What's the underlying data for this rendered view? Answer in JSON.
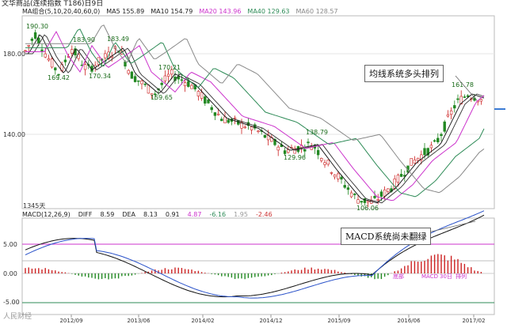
{
  "header": {
    "title": "文华商品(连续指数 T186)日9日"
  },
  "ma_legend": [
    {
      "label": "MA组合(5,10,20,40,60,0)",
      "color": "#333333"
    },
    {
      "label": "MA5 155.89",
      "color": "#111111"
    },
    {
      "label": "MA10 154.79",
      "color": "#111111"
    },
    {
      "label": "MA20 143.96",
      "color": "#cc33cc"
    },
    {
      "label": "MA40 129.63",
      "color": "#2e8b57"
    },
    {
      "label": "MA60 128.57",
      "color": "#888888"
    }
  ],
  "price_axis": {
    "labels": [
      "180.00",
      "140.00"
    ]
  },
  "price_marks": [
    "190.30",
    "169.42",
    "183.90",
    "170.34",
    "183.49",
    "159.65",
    "170.21",
    "138.79",
    "129.96",
    "106.06",
    "161.78"
  ],
  "days_label": "1345天",
  "annotations": {
    "ma_note": "均线系统多头排列",
    "macd_note": "MACD系统尚未翻绿"
  },
  "macd_legend": [
    {
      "label": "MACD(12,26,9)",
      "color": "#111111"
    },
    {
      "label": "DIFF",
      "color": "#111111"
    },
    {
      "label": "8.59",
      "color": "#111111"
    },
    {
      "label": "DEA",
      "color": "#111111"
    },
    {
      "label": "8.13",
      "color": "#111111"
    },
    {
      "label": "0.91",
      "color": "#111111"
    },
    {
      "label": "4.87",
      "color": "#cc33cc"
    },
    {
      "label": "-6.16",
      "color": "#2e8b57"
    },
    {
      "label": "1.95",
      "color": "#999999"
    },
    {
      "label": "-2.46",
      "color": "#cc3333"
    }
  ],
  "macd_axis": {
    "labels": [
      "5.00",
      "0.00",
      "-5.00"
    ]
  },
  "macd_marks": [
    "底部",
    "MACD",
    "30日",
    "排列"
  ],
  "dates": [
    "2012/09",
    "2013/06",
    "2014/02",
    "2014/12",
    "2015/09",
    "2016/06",
    "2017/02"
  ],
  "watermark": "人民财经",
  "colors": {
    "up": "#cc2222",
    "down": "#228822",
    "ma20": "#cc33cc",
    "ma40": "#2e8b57",
    "ma60": "#888888"
  }
}
